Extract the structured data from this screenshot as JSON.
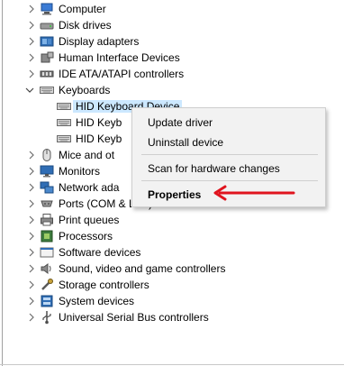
{
  "tree": [
    {
      "label": "Computer",
      "icon": "computer-icon",
      "state": "collapsed"
    },
    {
      "label": "Disk drives",
      "icon": "disk-drive-icon",
      "state": "collapsed"
    },
    {
      "label": "Display adapters",
      "icon": "display-adapter-icon",
      "state": "collapsed"
    },
    {
      "label": "Human Interface Devices",
      "icon": "hid-icon",
      "state": "collapsed"
    },
    {
      "label": "IDE ATA/ATAPI controllers",
      "icon": "ide-controller-icon",
      "state": "collapsed"
    },
    {
      "label": "Keyboards",
      "icon": "keyboard-icon",
      "state": "expanded"
    },
    {
      "label": "HID Keyboard Device",
      "icon": "keyboard-icon",
      "state": "child-selected"
    },
    {
      "label": "HID Keyb",
      "icon": "keyboard-icon",
      "state": "child"
    },
    {
      "label": "HID Keyb",
      "icon": "keyboard-icon",
      "state": "child"
    },
    {
      "label": "Mice and ot",
      "icon": "mouse-icon",
      "state": "collapsed"
    },
    {
      "label": "Monitors",
      "icon": "monitor-icon",
      "state": "collapsed"
    },
    {
      "label": "Network ada",
      "icon": "network-adapter-icon",
      "state": "collapsed"
    },
    {
      "label": "Ports (COM & LPT)",
      "icon": "port-icon",
      "state": "collapsed"
    },
    {
      "label": "Print queues",
      "icon": "printer-icon",
      "state": "collapsed"
    },
    {
      "label": "Processors",
      "icon": "processor-icon",
      "state": "collapsed"
    },
    {
      "label": "Software devices",
      "icon": "software-device-icon",
      "state": "collapsed"
    },
    {
      "label": "Sound, video and game controllers",
      "icon": "speaker-icon",
      "state": "collapsed"
    },
    {
      "label": "Storage controllers",
      "icon": "storage-controller-icon",
      "state": "collapsed"
    },
    {
      "label": "System devices",
      "icon": "system-device-icon",
      "state": "collapsed"
    },
    {
      "label": "Universal Serial Bus controllers",
      "icon": "usb-icon",
      "state": "collapsed"
    }
  ],
  "context_menu": {
    "update_driver": "Update driver",
    "uninstall_device": "Uninstall device",
    "scan_hardware": "Scan for hardware changes",
    "properties": "Properties"
  },
  "colors": {
    "selection": "#cce8ff",
    "menu_background": "#f2f2f2",
    "arrow": "#e0141e",
    "icon_blue": "#2a6fb5"
  }
}
